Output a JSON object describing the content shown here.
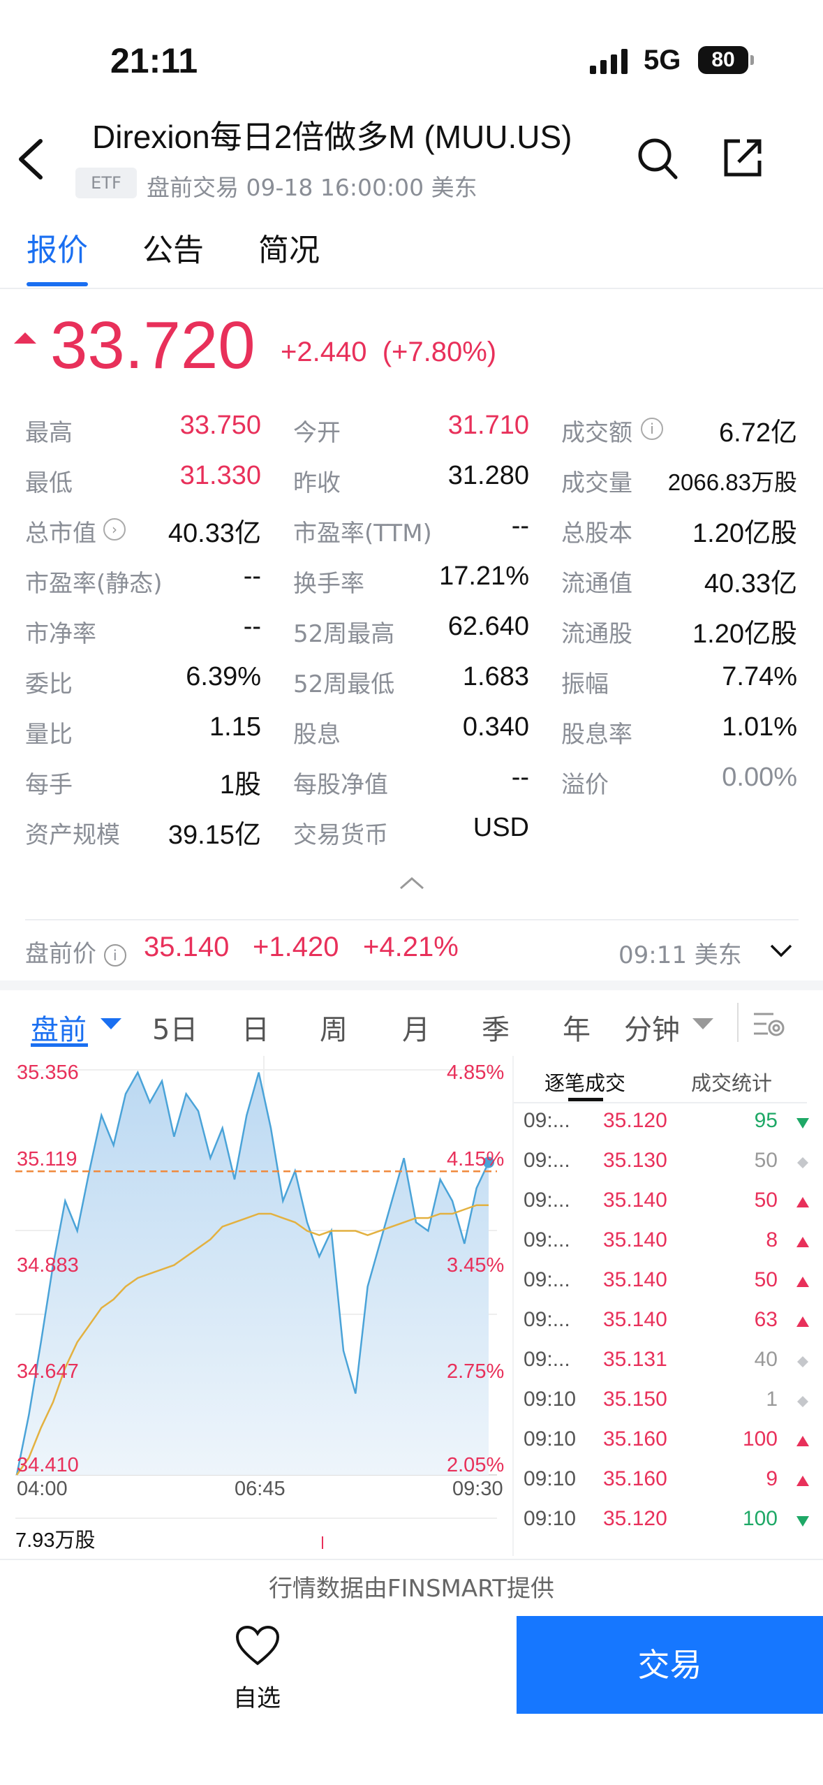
{
  "status_bar": {
    "time": "21:11",
    "network": "5G",
    "battery": "80"
  },
  "header": {
    "title": "Direxion每日2倍做多M (MUU.US)",
    "badge": "ETF",
    "subtitle": "盘前交易  09-18 16:00:00  美东"
  },
  "tabs": [
    "报价",
    "公告",
    "简况"
  ],
  "quote": {
    "price": "33.720",
    "change": "+2.440",
    "change_pct": "(+7.80%)"
  },
  "stats": [
    [
      {
        "label": "最高",
        "value": "33.750",
        "color": "red"
      },
      {
        "label": "今开",
        "value": "31.710",
        "color": "red"
      },
      {
        "label": "成交额",
        "value": "6.72亿",
        "info": true
      }
    ],
    [
      {
        "label": "最低",
        "value": "31.330",
        "color": "red"
      },
      {
        "label": "昨收",
        "value": "31.280"
      },
      {
        "label": "成交量",
        "value": "2066.83万股",
        "small": true
      }
    ],
    [
      {
        "label": "总市值",
        "value": "40.33亿",
        "chev": true
      },
      {
        "label": "市盈率(TTM)",
        "value": "--"
      },
      {
        "label": "总股本",
        "value": "1.20亿股"
      }
    ],
    [
      {
        "label": "市盈率(静态)",
        "value": "--"
      },
      {
        "label": "换手率",
        "value": "17.21%"
      },
      {
        "label": "流通值",
        "value": "40.33亿"
      }
    ],
    [
      {
        "label": "市净率",
        "value": "--"
      },
      {
        "label": "52周最高",
        "value": "62.640"
      },
      {
        "label": "流通股",
        "value": "1.20亿股"
      }
    ],
    [
      {
        "label": "委比",
        "value": "6.39%"
      },
      {
        "label": "52周最低",
        "value": "1.683"
      },
      {
        "label": "振幅",
        "value": "7.74%"
      }
    ],
    [
      {
        "label": "量比",
        "value": "1.15"
      },
      {
        "label": "股息",
        "value": "0.340"
      },
      {
        "label": "股息率",
        "value": "1.01%"
      }
    ],
    [
      {
        "label": "每手",
        "value": "1股"
      },
      {
        "label": "每股净值",
        "value": "--"
      },
      {
        "label": "溢价",
        "value": "0.00%",
        "color": "grey"
      }
    ],
    [
      {
        "label": "资产规模",
        "value": "39.15亿"
      },
      {
        "label": "交易货币",
        "value": "USD"
      }
    ]
  ],
  "premarket": {
    "label": "盘前价",
    "price": "35.140",
    "change": "+1.420",
    "pct": "+4.21%",
    "time": "09:11  美东"
  },
  "chart_tabs": [
    "盘前",
    "5日",
    "日",
    "周",
    "月",
    "季",
    "年",
    "分钟"
  ],
  "chart_data": {
    "type": "line",
    "y_left": [
      "35.356",
      "35.119",
      "34.883",
      "34.647",
      "34.410"
    ],
    "y_right": [
      "4.85%",
      "4.15%",
      "3.45%",
      "2.75%",
      "2.05%"
    ],
    "x_ticks": [
      "04:00",
      "06:45",
      "09:30"
    ],
    "ylim": [
      34.41,
      35.356
    ],
    "prev_ref": 35.119,
    "price_series": [
      34.41,
      34.55,
      34.72,
      34.9,
      35.05,
      34.98,
      35.12,
      35.25,
      35.18,
      35.3,
      35.35,
      35.28,
      35.33,
      35.2,
      35.3,
      35.26,
      35.15,
      35.22,
      35.1,
      35.25,
      35.35,
      35.22,
      35.05,
      35.12,
      35.0,
      34.92,
      34.98,
      34.7,
      34.6,
      34.85,
      34.95,
      35.05,
      35.15,
      35.0,
      34.98,
      35.1,
      35.05,
      34.95,
      35.08,
      35.14
    ],
    "avg_series": [
      34.41,
      34.45,
      34.52,
      34.58,
      34.66,
      34.72,
      34.76,
      34.8,
      34.82,
      34.85,
      34.87,
      34.88,
      34.89,
      34.9,
      34.92,
      34.94,
      34.96,
      34.99,
      35.0,
      35.01,
      35.02,
      35.02,
      35.01,
      35.0,
      34.98,
      34.97,
      34.98,
      34.98,
      34.98,
      34.97,
      34.98,
      34.99,
      35.0,
      35.01,
      35.01,
      35.02,
      35.02,
      35.03,
      35.04,
      35.04
    ],
    "volume_label": "7.93万股"
  },
  "trade_panel": {
    "tabs": [
      "逐笔成交",
      "成交统计"
    ],
    "rows": [
      {
        "t": "09:...",
        "p": "35.120",
        "v": "95",
        "dir": "down"
      },
      {
        "t": "09:...",
        "p": "35.130",
        "v": "50",
        "dir": "flat"
      },
      {
        "t": "09:...",
        "p": "35.140",
        "v": "50",
        "dir": "up"
      },
      {
        "t": "09:...",
        "p": "35.140",
        "v": "8",
        "dir": "up"
      },
      {
        "t": "09:...",
        "p": "35.140",
        "v": "50",
        "dir": "up"
      },
      {
        "t": "09:...",
        "p": "35.140",
        "v": "63",
        "dir": "up"
      },
      {
        "t": "09:...",
        "p": "35.131",
        "v": "40",
        "dir": "flat"
      },
      {
        "t": "09:10",
        "p": "35.150",
        "v": "1",
        "dir": "flat"
      },
      {
        "t": "09:10",
        "p": "35.160",
        "v": "100",
        "dir": "up"
      },
      {
        "t": "09:10",
        "p": "35.160",
        "v": "9",
        "dir": "up"
      },
      {
        "t": "09:10",
        "p": "35.120",
        "v": "100",
        "dir": "down"
      }
    ]
  },
  "footer": {
    "note": "行情数据由FINSMART提供",
    "watch_label": "自选",
    "trade_label": "交易"
  },
  "colors": {
    "up": "#e8305a",
    "down": "#1ea866",
    "accent": "#1677ff"
  }
}
